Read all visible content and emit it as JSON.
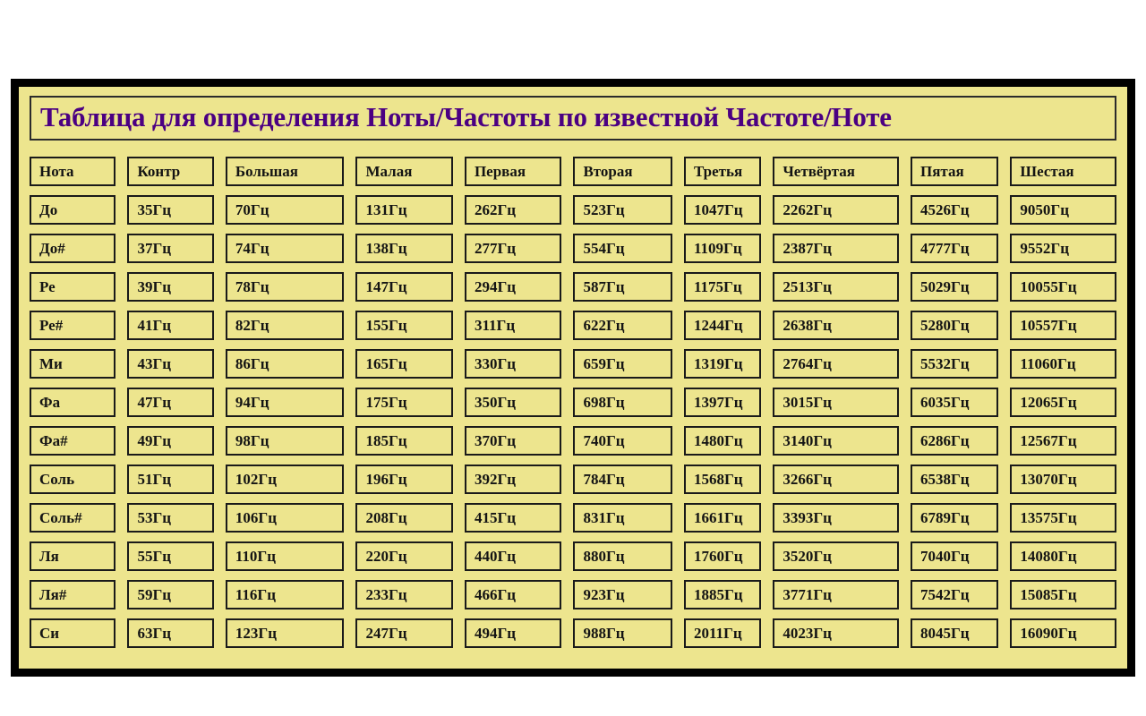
{
  "page": {
    "background_color": "#ffffff",
    "frame_border_color": "#000000",
    "panel_color": "#EDE58E",
    "title_color": "#4B0082",
    "text_color": "#141414"
  },
  "title": "Таблица для определения Ноты/Частоты по известной Частоте/Ноте",
  "table": {
    "headers": [
      "Нота",
      "Контр",
      "Большая",
      "Малая",
      "Первая",
      "Вторая",
      "Третья",
      "Четвёртая",
      "Пятая",
      "Шестая"
    ],
    "rows": [
      {
        "note": "До",
        "values": [
          "35Гц",
          "70Гц",
          "131Гц",
          "262Гц",
          "523Гц",
          "1047Гц",
          "2262Гц",
          "4526Гц",
          "9050Гц"
        ]
      },
      {
        "note": "До#",
        "values": [
          "37Гц",
          "74Гц",
          "138Гц",
          "277Гц",
          "554Гц",
          "1109Гц",
          "2387Гц",
          "4777Гц",
          "9552Гц"
        ]
      },
      {
        "note": "Ре",
        "values": [
          "39Гц",
          "78Гц",
          "147Гц",
          "294Гц",
          "587Гц",
          "1175Гц",
          "2513Гц",
          "5029Гц",
          "10055Гц"
        ]
      },
      {
        "note": "Ре#",
        "values": [
          "41Гц",
          "82Гц",
          "155Гц",
          "311Гц",
          "622Гц",
          "1244Гц",
          "2638Гц",
          "5280Гц",
          "10557Гц"
        ]
      },
      {
        "note": "Ми",
        "values": [
          "43Гц",
          "86Гц",
          "165Гц",
          "330Гц",
          "659Гц",
          "1319Гц",
          "2764Гц",
          "5532Гц",
          "11060Гц"
        ]
      },
      {
        "note": "Фа",
        "values": [
          "47Гц",
          "94Гц",
          "175Гц",
          "350Гц",
          "698Гц",
          "1397Гц",
          "3015Гц",
          "6035Гц",
          "12065Гц"
        ]
      },
      {
        "note": "Фа#",
        "values": [
          "49Гц",
          "98Гц",
          "185Гц",
          "370Гц",
          "740Гц",
          "1480Гц",
          "3140Гц",
          "6286Гц",
          "12567Гц"
        ]
      },
      {
        "note": "Соль",
        "values": [
          "51Гц",
          "102Гц",
          "196Гц",
          "392Гц",
          "784Гц",
          "1568Гц",
          "3266Гц",
          "6538Гц",
          "13070Гц"
        ]
      },
      {
        "note": "Соль#",
        "values": [
          "53Гц",
          "106Гц",
          "208Гц",
          "415Гц",
          "831Гц",
          "1661Гц",
          "3393Гц",
          "6789Гц",
          "13575Гц"
        ]
      },
      {
        "note": "Ля",
        "values": [
          "55Гц",
          "110Гц",
          "220Гц",
          "440Гц",
          "880Гц",
          "1760Гц",
          "3520Гц",
          "7040Гц",
          "14080Гц"
        ]
      },
      {
        "note": "Ля#",
        "values": [
          "59Гц",
          "116Гц",
          "233Гц",
          "466Гц",
          "923Гц",
          "1885Гц",
          "3771Гц",
          "7542Гц",
          "15085Гц"
        ]
      },
      {
        "note": "Си",
        "values": [
          "63Гц",
          "123Гц",
          "247Гц",
          "494Гц",
          "988Гц",
          "2011Гц",
          "4023Гц",
          "8045Гц",
          "16090Гц"
        ]
      }
    ]
  }
}
